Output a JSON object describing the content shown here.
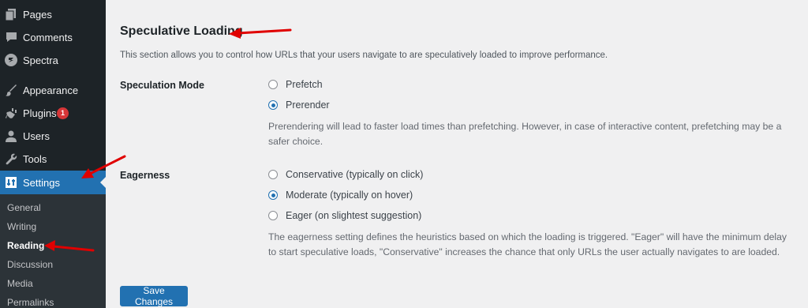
{
  "sidebar": {
    "items": [
      {
        "label": "Pages",
        "icon": "pages-icon"
      },
      {
        "label": "Comments",
        "icon": "comments-icon"
      },
      {
        "label": "Spectra",
        "icon": "spectra-icon"
      },
      {
        "label": "Appearance",
        "icon": "appearance-icon"
      },
      {
        "label": "Plugins",
        "icon": "plugins-icon",
        "badge": "1"
      },
      {
        "label": "Users",
        "icon": "users-icon"
      },
      {
        "label": "Tools",
        "icon": "tools-icon"
      },
      {
        "label": "Settings",
        "icon": "settings-icon",
        "active": true
      }
    ],
    "submenu": [
      "General",
      "Writing",
      "Reading",
      "Discussion",
      "Media",
      "Permalinks"
    ],
    "current_submenu": "Reading"
  },
  "main": {
    "section_title": "Speculative Loading",
    "section_description": "This section allows you to control how URLs that your users navigate to are speculatively loaded to improve performance.",
    "speculation_mode": {
      "label": "Speculation Mode",
      "options": [
        "Prefetch",
        "Prerender"
      ],
      "selected": "Prerender",
      "help": "Prerendering will lead to faster load times than prefetching. However, in case of interactive content, prefetching may be a safer choice."
    },
    "eagerness": {
      "label": "Eagerness",
      "options": [
        "Conservative (typically on click)",
        "Moderate (typically on hover)",
        "Eager (on slightest suggestion)"
      ],
      "selected": "Moderate (typically on hover)",
      "help": "The eagerness setting defines the heuristics based on which the loading is triggered. \"Eager\" will have the minimum delay to start speculative loads, \"Conservative\" increases the chance that only URLs the user actually navigates to are loaded."
    },
    "save_label": "Save Changes"
  },
  "colors": {
    "sidebar_bg": "#1d2327",
    "submenu_bg": "#2c3338",
    "accent": "#2271b1",
    "annotation_arrow": "#e00000",
    "badge": "#d63638"
  }
}
